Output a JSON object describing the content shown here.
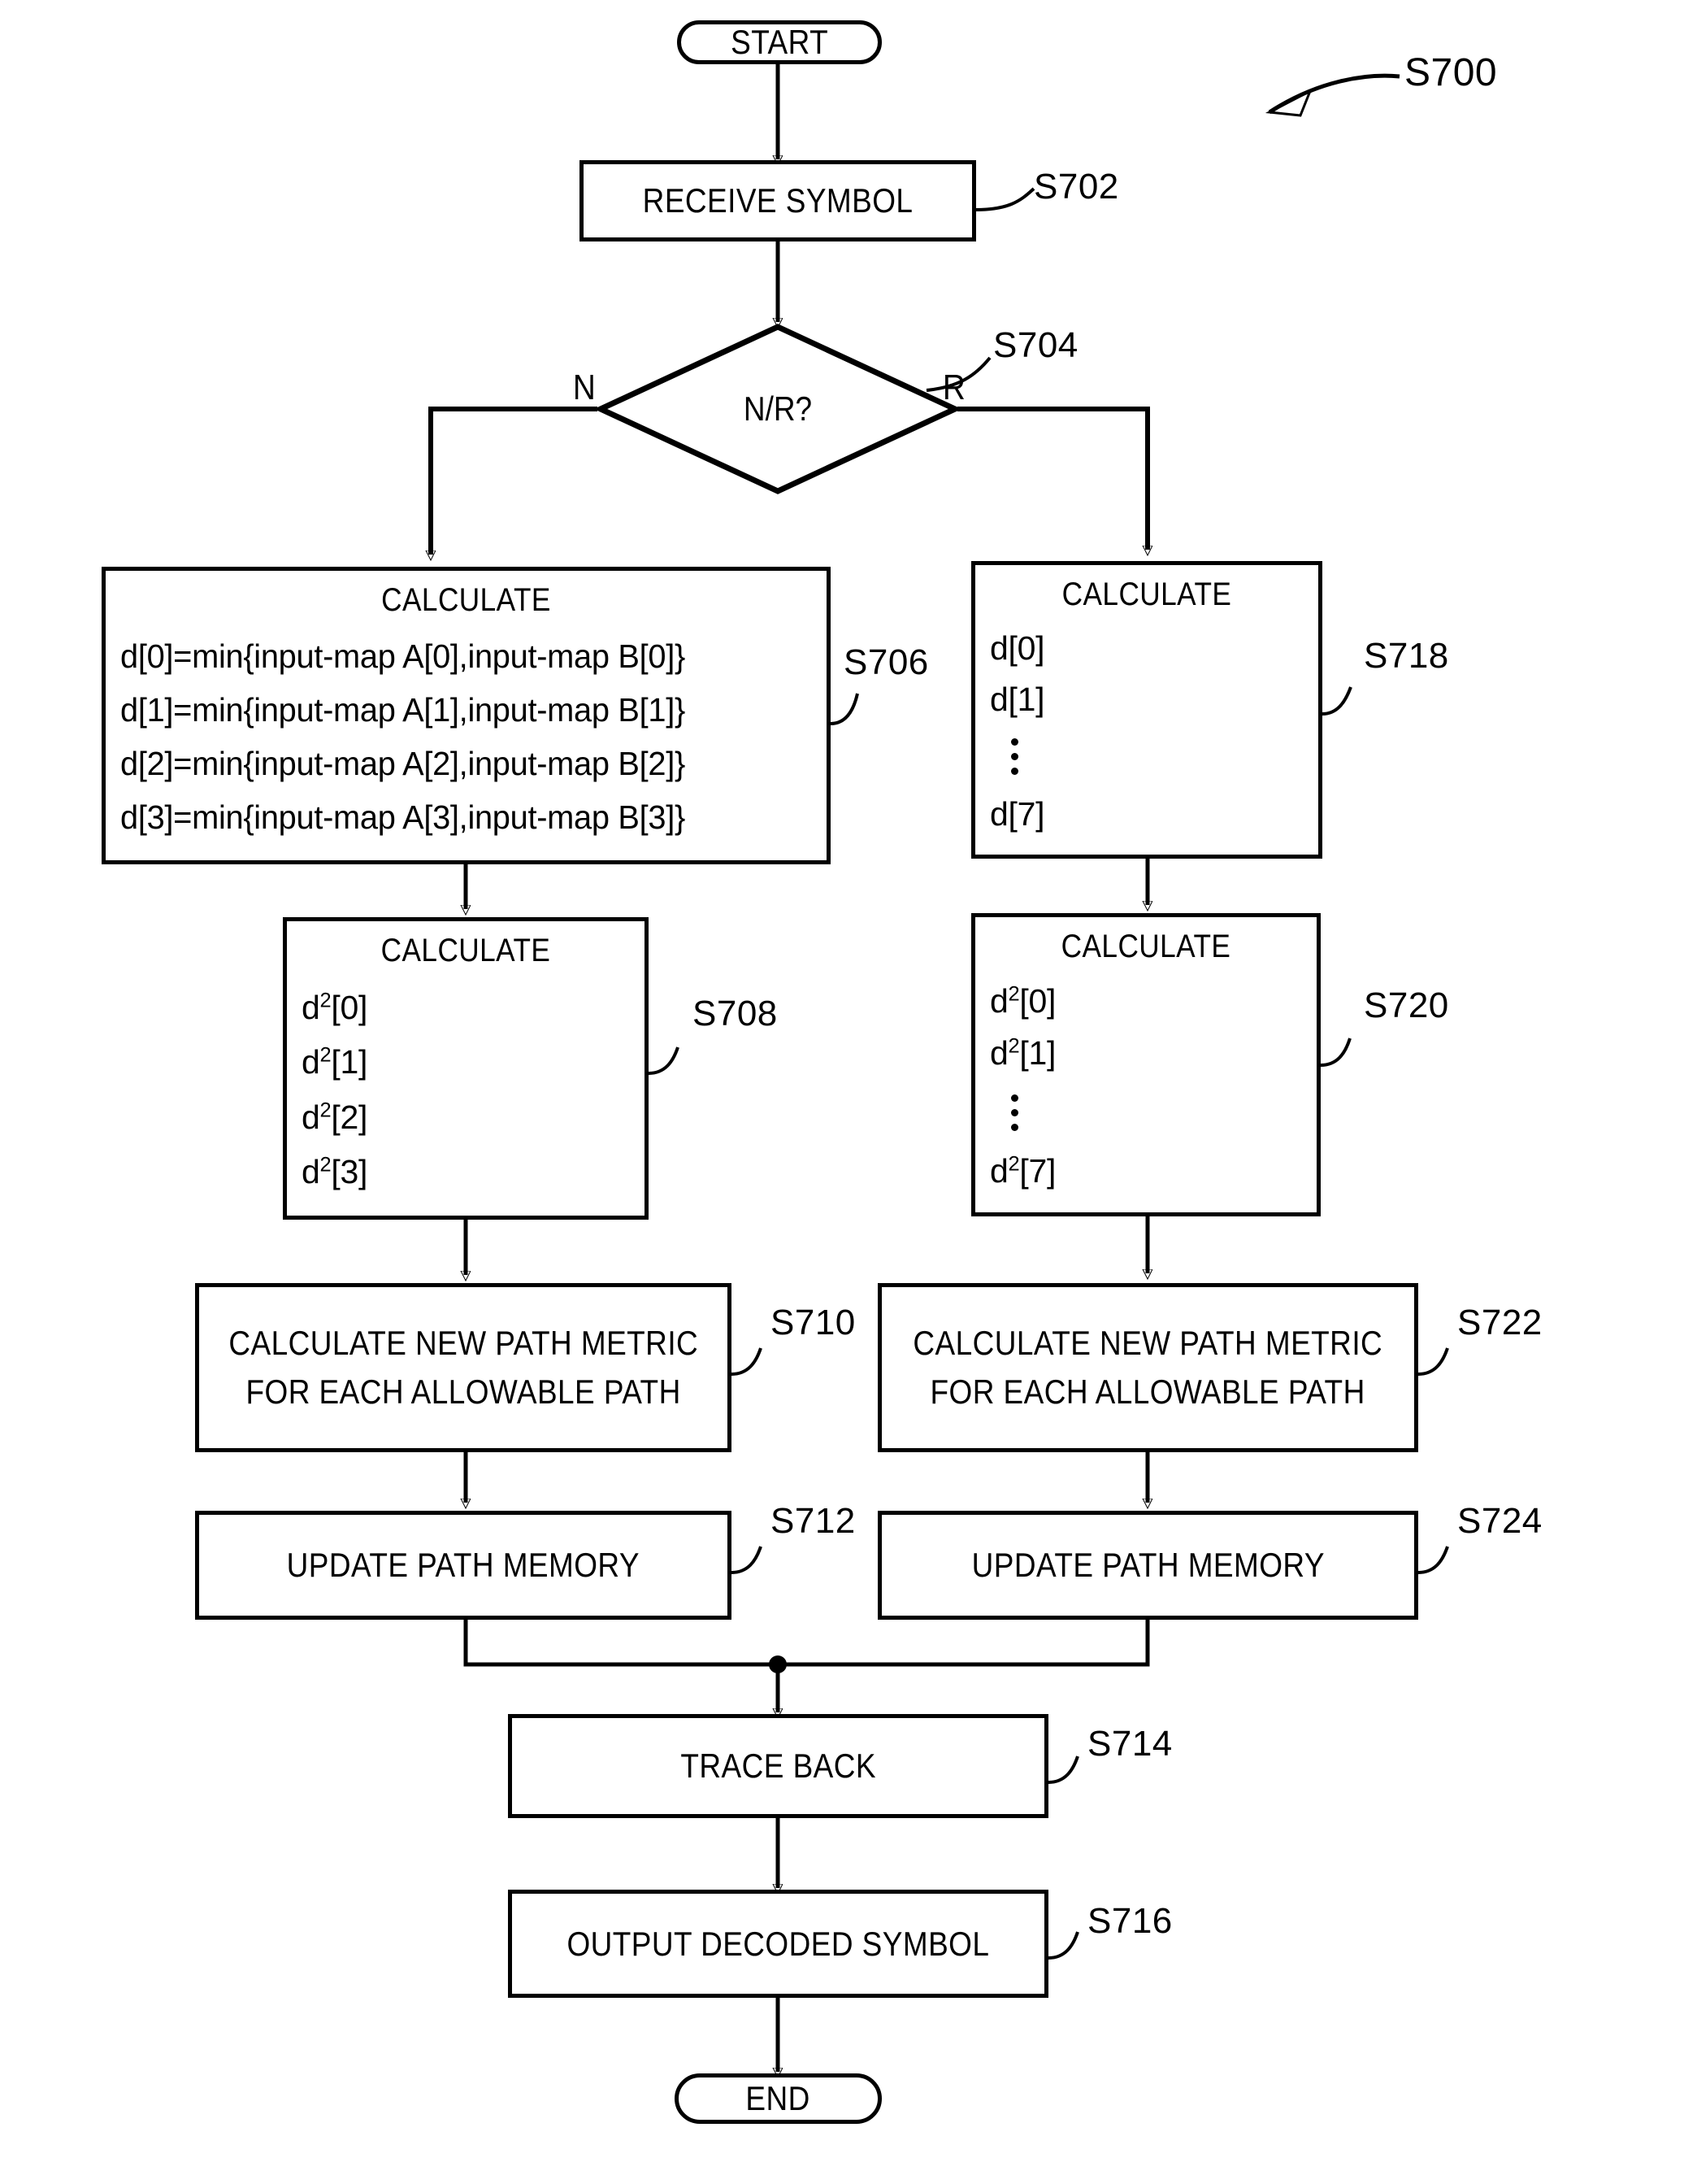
{
  "figure": {
    "reference": "S700",
    "type": "flowchart",
    "orientation": "top-to-bottom",
    "description": "Viterbi-style symbol decoding flowchart with N and R branches"
  },
  "nodes": {
    "start": {
      "label": "START",
      "shape": "terminator"
    },
    "receive_symbol": {
      "label": "RECEIVE SYMBOL",
      "shape": "process",
      "ref": "S702"
    },
    "decision": {
      "label": "N/R?",
      "shape": "decision",
      "ref": "S704",
      "branch_left": "N",
      "branch_right": "R"
    },
    "calc_n_d": {
      "head": "CALCULATE",
      "ref": "S706",
      "lines": [
        "d[0]=min{input-map A[0],input-map B[0]}",
        "d[1]=min{input-map A[1],input-map B[1]}",
        "d[2]=min{input-map A[2],input-map B[2]}",
        "d[3]=min{input-map A[3],input-map B[3]}"
      ]
    },
    "calc_n_d2": {
      "head": "CALCULATE",
      "ref": "S708",
      "lines": [
        "d2[0]",
        "d2[1]",
        "d2[2]",
        "d2[3]"
      ]
    },
    "path_metric_n": {
      "label_line1": "CALCULATE NEW PATH METRIC",
      "label_line2": "FOR EACH ALLOWABLE PATH",
      "ref": "S710"
    },
    "update_memory_n": {
      "label": "UPDATE PATH MEMORY",
      "ref": "S712"
    },
    "calc_r_d": {
      "head": "CALCULATE",
      "ref": "S718",
      "lines": [
        "d[0]",
        "d[1]",
        "⋮",
        "d[7]"
      ]
    },
    "calc_r_d2": {
      "head": "CALCULATE",
      "ref": "S720",
      "lines": [
        "d2[0]",
        "d2[1]",
        "⋮",
        "d2[7]"
      ]
    },
    "path_metric_r": {
      "label_line1": "CALCULATE NEW PATH METRIC",
      "label_line2": "FOR EACH ALLOWABLE PATH",
      "ref": "S722"
    },
    "update_memory_r": {
      "label": "UPDATE PATH MEMORY",
      "ref": "S724"
    },
    "trace_back": {
      "label": "TRACE BACK",
      "ref": "S714"
    },
    "output_symbol": {
      "label": "OUTPUT DECODED SYMBOL",
      "ref": "S716"
    },
    "end": {
      "label": "END",
      "shape": "terminator"
    }
  },
  "formula_parts": {
    "d_base": "d",
    "superscript": "2",
    "index_0": "[0]",
    "index_1": "[1]",
    "index_2": "[2]",
    "index_3": "[3]",
    "index_7": "[7]"
  },
  "colors": {
    "stroke": "#000000",
    "background": "#ffffff",
    "text": "#000000"
  }
}
